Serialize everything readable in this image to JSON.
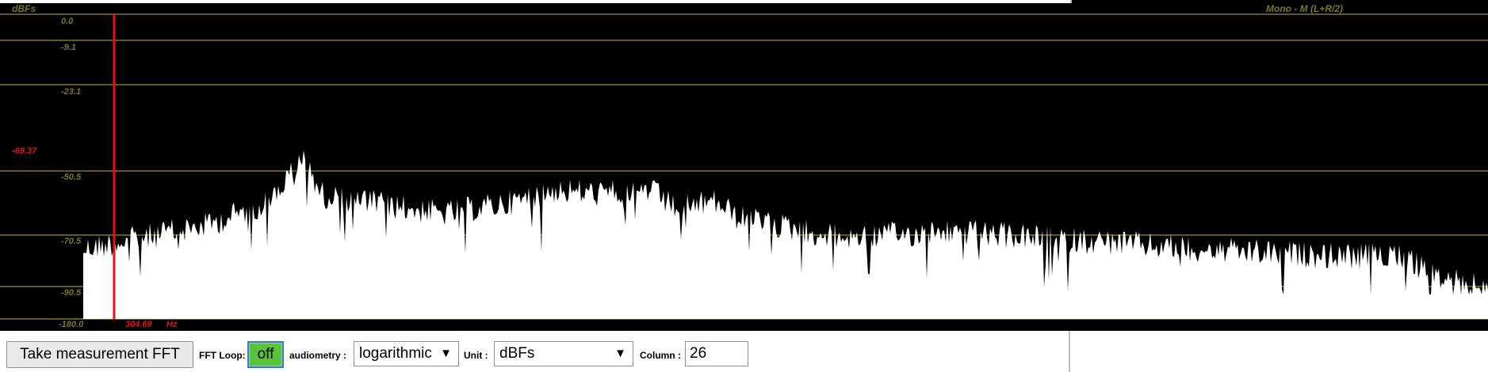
{
  "plot": {
    "unit_label": "dBFs",
    "channel_label": "Mono - M (L+R/2)",
    "y_ticks": [
      "0.0",
      "-9.1",
      "-23.1",
      "-50.5",
      "-70.5",
      "-90.5",
      "-180.0"
    ],
    "cursor_value": "-69.37",
    "cursor_freq": "304.69",
    "cursor_freq_unit": "Hz",
    "colors": {
      "background": "#000000",
      "grid": "#5f5b1f",
      "axis_text": "#77772a",
      "cursor": "#e01414",
      "spectrum": "#ffffff"
    }
  },
  "toolbar": {
    "measure_button": "Take measurement FFT",
    "fft_loop_label": "FFT Loop:",
    "fft_loop_value": "off",
    "fft_loop_color": "#58c538",
    "audiometry_label": "audiometry :",
    "audiometry_value": "logarithmic",
    "unit_label": "Unit :",
    "unit_value": "dBFs",
    "column_label": "Column :",
    "column_value": "26",
    "dropdown_arrow": "▼"
  }
}
